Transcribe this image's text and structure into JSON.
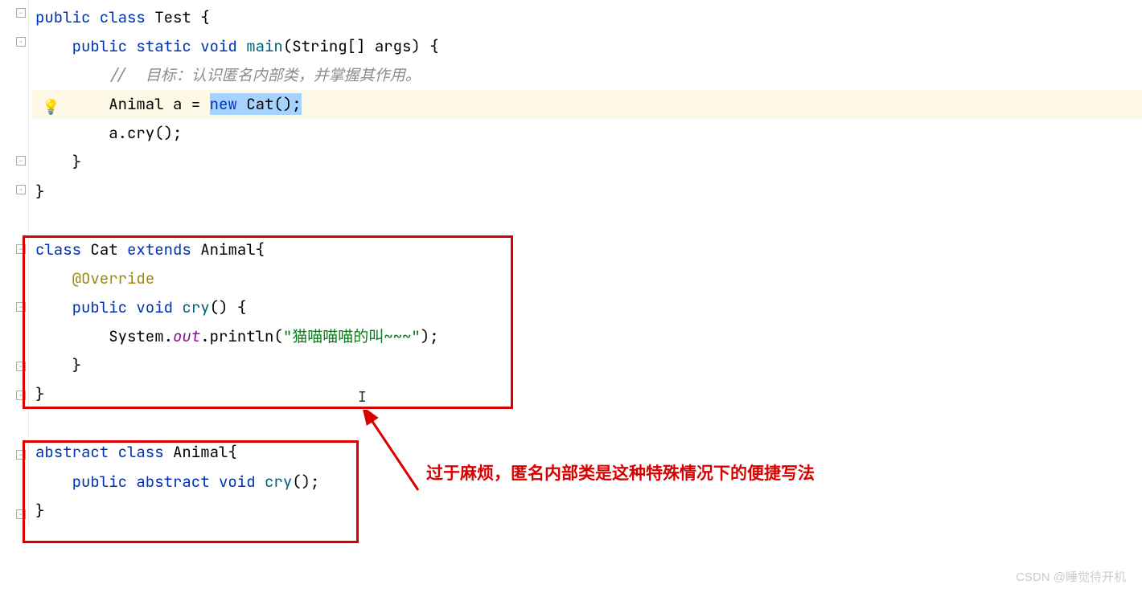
{
  "code": {
    "block1": {
      "l1_kw1": "public class",
      "l1_name": " Test {",
      "l2_kw": "public static void",
      "l2_name": " main",
      "l2_params": "(String[] args) {",
      "l3_comment": "//  目标：认识匿名内部类，并掌握其作用。",
      "l4_type": "Animal a = ",
      "l4_sel_kw": "new",
      "l4_sel_rest": " Cat();",
      "l5": "a.cry();",
      "l6": "}",
      "l7": "}"
    },
    "block2": {
      "l1_kw": "class",
      "l1_name": " Cat ",
      "l1_kw2": "extends",
      "l1_name2": " Animal{",
      "l2_ann": "@Override",
      "l3_kw": "public void",
      "l3_name": " cry",
      "l3_rest": "() {",
      "l4_a": "System.",
      "l4_b": "out",
      "l4_c": ".println(",
      "l4_str": "\"猫喵喵喵的叫~~~\"",
      "l4_d": ");",
      "l5": "}",
      "l6": "}"
    },
    "block3": {
      "l1_kw": "abstract class",
      "l1_name": " Animal{",
      "l2_kw": "public abstract void",
      "l2_name": " cry",
      "l2_rest": "();",
      "l3": "}"
    }
  },
  "annotation": "过于麻烦，匿名内部类是这种特殊情况下的便捷写法",
  "watermark": "CSDN @睡觉待开机"
}
